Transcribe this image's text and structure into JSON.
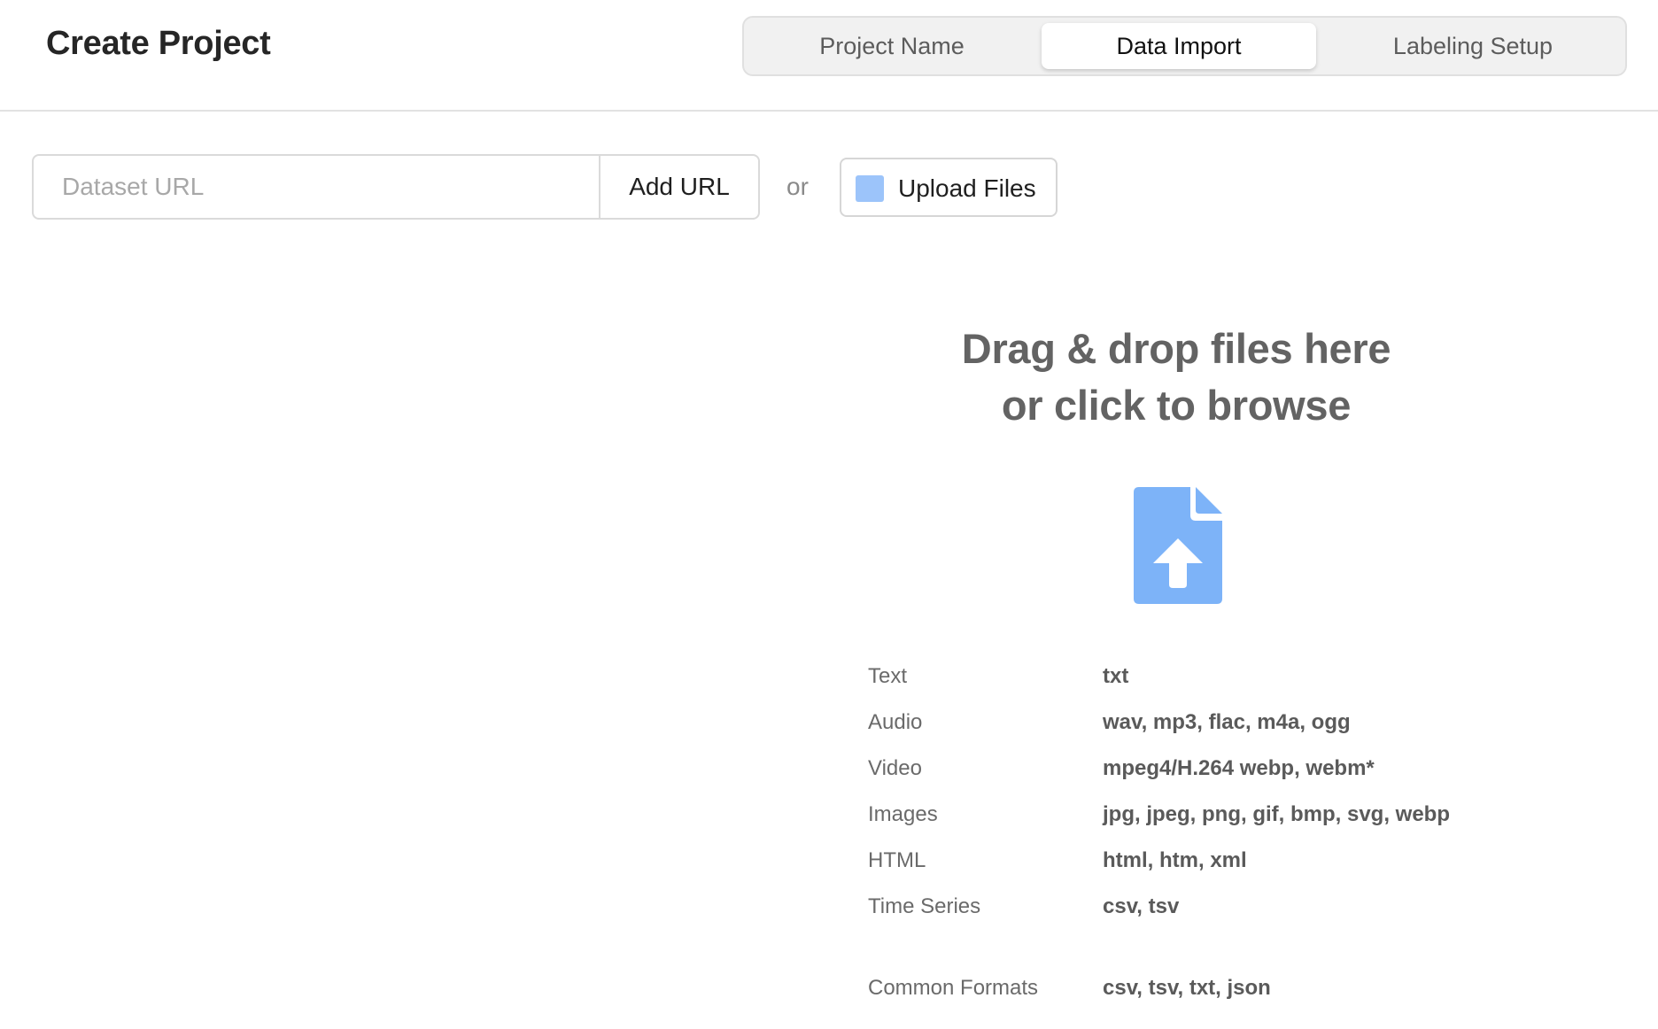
{
  "header": {
    "title": "Create Project",
    "steps": [
      {
        "label": "Project Name",
        "active": false
      },
      {
        "label": "Data Import",
        "active": true
      },
      {
        "label": "Labeling Setup",
        "active": false
      }
    ]
  },
  "import_bar": {
    "url_placeholder": "Dataset URL",
    "url_value": "",
    "add_url_label": "Add URL",
    "or_label": "or",
    "upload_label": "Upload Files",
    "upload_swatch_color": "#9cc4fa"
  },
  "dropzone": {
    "title_line1": "Drag & drop files here",
    "title_line2": "or click to browse",
    "icon": "file-upload-icon",
    "icon_color": "#7db3f8"
  },
  "formats": [
    {
      "name": "Text",
      "exts": "txt"
    },
    {
      "name": "Audio",
      "exts": "wav, mp3, flac, m4a, ogg"
    },
    {
      "name": "Video",
      "exts": "mpeg4/H.264 webp, webm*"
    },
    {
      "name": "Images",
      "exts": "jpg, jpeg, png, gif, bmp, svg, webp"
    },
    {
      "name": "HTML",
      "exts": "html, htm, xml"
    },
    {
      "name": "Time Series",
      "exts": "csv, tsv"
    },
    {
      "name": "Common Formats",
      "exts": "csv, tsv, txt, json"
    }
  ]
}
